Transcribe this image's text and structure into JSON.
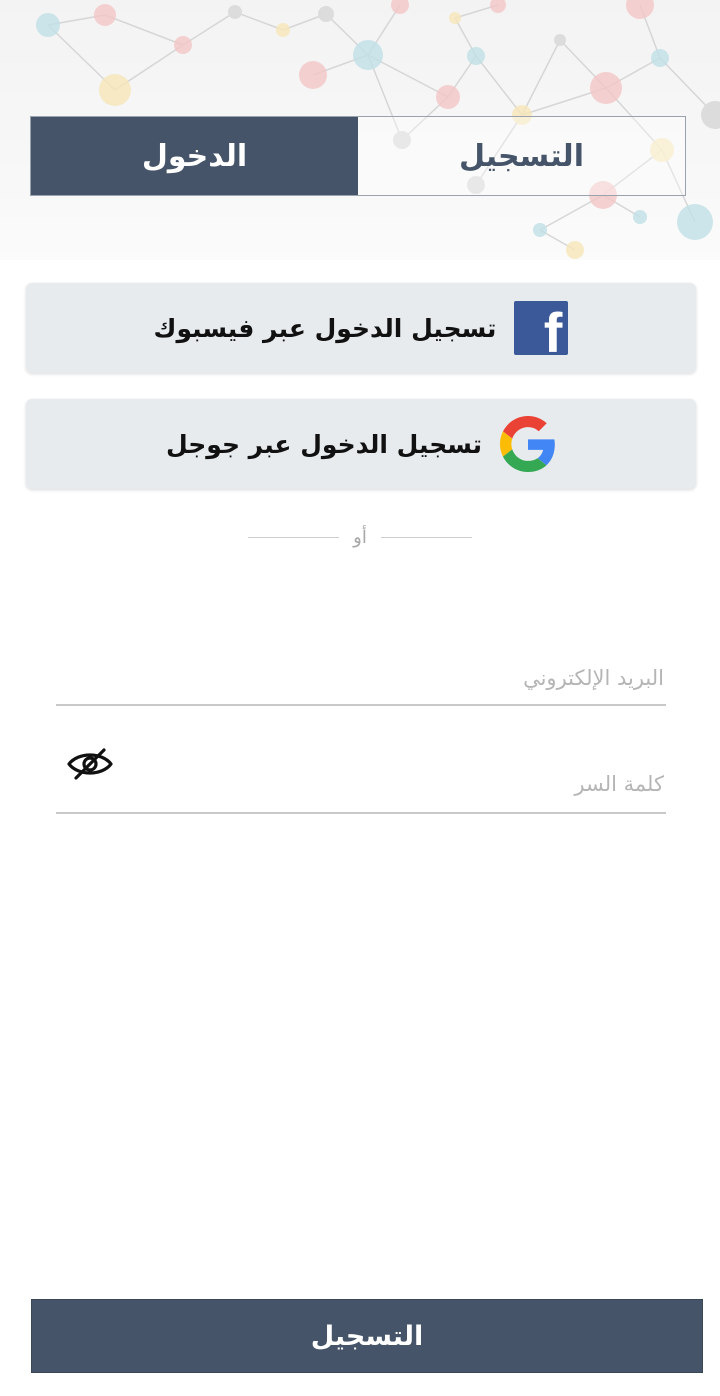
{
  "tabs": {
    "login": "الدخول",
    "register": "التسجيل"
  },
  "social": {
    "facebook_label": "تسجيل الدخول عبر فيسبوك",
    "google_label": "تسجيل الدخول عبر جوجل",
    "facebook_icon": "facebook-icon",
    "google_icon": "google-icon"
  },
  "divider": {
    "or": "أو"
  },
  "form": {
    "email_placeholder": "البريد الإلكتروني",
    "email_value": "",
    "password_placeholder": "كلمة السر",
    "password_value": "",
    "toggle_icon": "eye-off-icon"
  },
  "submit_label": "التسجيل",
  "colors": {
    "primary": "#455468",
    "facebook": "#3b5998",
    "button_bg": "#e8ebee"
  }
}
